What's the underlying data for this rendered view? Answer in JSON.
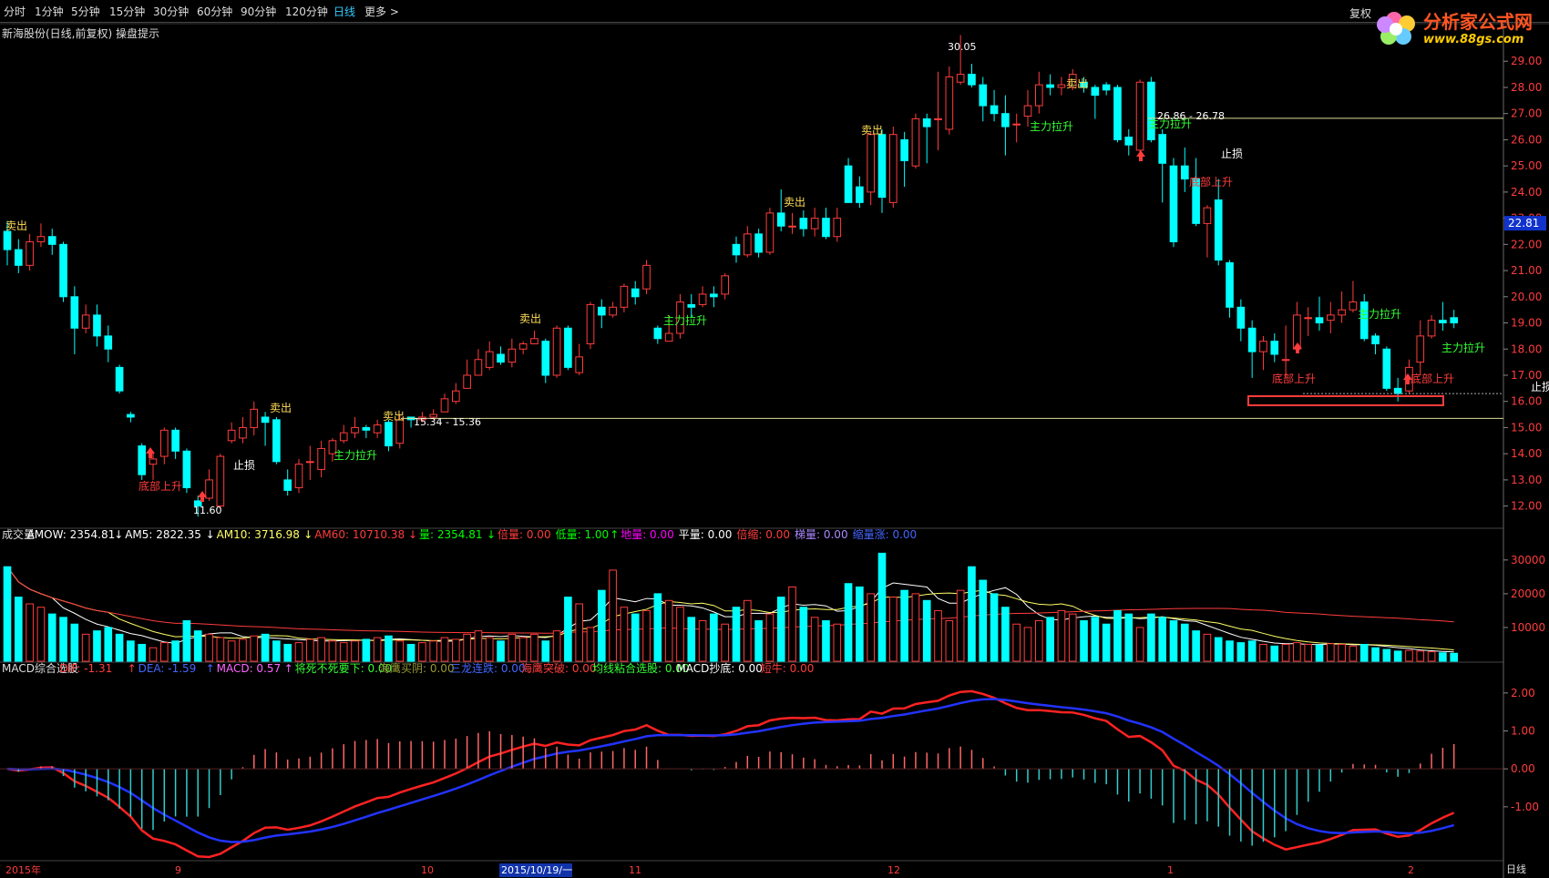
{
  "toolbar": {
    "tabs": [
      "分时",
      "1分钟",
      "5分钟",
      "15分钟",
      "30分钟",
      "60分钟",
      "90分钟",
      "120分钟",
      "日线",
      "更多 >"
    ],
    "active_tab": "日线",
    "fuquan": "复权"
  },
  "title": "新海股份(日线,前复权) 操盘提示",
  "logo": {
    "name": "分析家公式网",
    "url": "www.88gs.com"
  },
  "colors": {
    "up": "#ff3c3c",
    "down": "#00ffff",
    "ma_white": "#ffffff",
    "ma_yellow": "#ffff00",
    "ma_red": "#ff3c3c",
    "bg": "#000000"
  },
  "price_axis": [
    "29.00",
    "28.00",
    "27.00",
    "26.00",
    "25.00",
    "24.00",
    "23.00",
    "22.00",
    "21.00",
    "20.00",
    "19.00",
    "18.00",
    "17.00",
    "16.00",
    "15.00",
    "14.00",
    "13.00",
    "12.00"
  ],
  "current_price": "22.81",
  "price_annotations": {
    "high": "30.05",
    "low": "11.60",
    "range1": "15.34 - 15.36",
    "range2": "26.86 - 26.78",
    "stop": "止损",
    "sell": "卖出",
    "main_up": "主力拉升",
    "bottom_up": "底部上升"
  },
  "volume_legend": [
    {
      "label": "成交量",
      "color": "#dddddd"
    },
    {
      "label": "AMOW: 2354.81",
      "color": "#ffffff",
      "arrow": "↓"
    },
    {
      "label": "AM5: 2822.35",
      "color": "#ffffff",
      "arrow": "↓"
    },
    {
      "label": "AM10: 3716.98",
      "color": "#ffff66",
      "arrow": "↓"
    },
    {
      "label": "AM60: 10710.38",
      "color": "#ff3c3c",
      "arrow": "↓"
    },
    {
      "label": "量: 2354.81",
      "color": "#00ff00",
      "arrow": "↓"
    },
    {
      "label": "倍量: 0.00",
      "color": "#ff3c3c"
    },
    {
      "label": "低量: 1.00",
      "color": "#00ff00",
      "arrow": "↑"
    },
    {
      "label": "地量: 0.00",
      "color": "#ff00ff"
    },
    {
      "label": "平量: 0.00",
      "color": "#ffffff"
    },
    {
      "label": "倍缩: 0.00",
      "color": "#ff3c3c"
    },
    {
      "label": "梯量: 0.00",
      "color": "#aa88ff"
    },
    {
      "label": "缩量涨: 0.00",
      "color": "#4466ff"
    }
  ],
  "volume_axis": [
    "30000",
    "20000",
    "10000"
  ],
  "macd_legend": [
    {
      "label": "MACD综合选股",
      "color": "#dddddd"
    },
    {
      "label": "DIF: -1.31",
      "color": "#ff3c3c",
      "arrow": "↑"
    },
    {
      "label": "DEA: -1.59",
      "color": "#4466ff",
      "arrow": "↑"
    },
    {
      "label": "MACD: 0.57",
      "color": "#ff66ff",
      "arrow": "↑"
    },
    {
      "label": "将死不死要下: 0.00",
      "color": "#33ff33"
    },
    {
      "label": "海鹰买阴: 0.00",
      "color": "#999933"
    },
    {
      "label": "三龙连跌: 0.00",
      "color": "#4466ff"
    },
    {
      "label": "海鹰突破: 0.00",
      "color": "#ff3c3c"
    },
    {
      "label": "均线粘合选股: 0.00",
      "color": "#33ff33"
    },
    {
      "label": "MACD抄底: 0.00",
      "color": "#ffffff"
    },
    {
      "label": "短牛: 0.00",
      "color": "#ff3c3c"
    }
  ],
  "macd_axis": [
    "2.00",
    "1.00",
    "0.00",
    "-1.00"
  ],
  "date_axis": [
    {
      "label": "2015年"
    },
    {
      "label": "9"
    },
    {
      "label": "10"
    },
    {
      "label": "2015/10/19/一"
    },
    {
      "label": "11"
    },
    {
      "label": "12"
    },
    {
      "label": "1"
    },
    {
      "label": "2"
    }
  ],
  "period": "日线",
  "chart_data": {
    "type": "candlestick",
    "title": "新海股份(日线,前复权)",
    "ylim": [
      11.5,
      29.6
    ],
    "candles": [
      [
        22.5,
        21.8,
        22.9,
        21.2
      ],
      [
        21.8,
        21.2,
        22.2,
        20.9
      ],
      [
        21.2,
        22.1,
        22.4,
        21.0
      ],
      [
        22.1,
        22.3,
        22.8,
        21.9
      ],
      [
        22.3,
        22.0,
        22.6,
        21.6
      ],
      [
        22.0,
        20.0,
        22.1,
        19.8
      ],
      [
        20.0,
        18.8,
        20.4,
        17.8
      ],
      [
        18.8,
        19.3,
        19.7,
        18.6
      ],
      [
        19.3,
        18.5,
        19.7,
        18.1
      ],
      [
        18.5,
        18.0,
        18.9,
        17.5
      ],
      [
        17.3,
        16.4,
        17.4,
        16.3
      ],
      [
        15.5,
        15.4,
        15.6,
        15.2
      ],
      [
        14.3,
        13.2,
        14.4,
        13.0
      ],
      [
        13.6,
        13.8,
        14.1,
        13.0
      ],
      [
        13.9,
        14.9,
        15.0,
        13.6
      ],
      [
        14.9,
        14.1,
        15.0,
        13.8
      ],
      [
        14.1,
        12.7,
        14.2,
        12.5
      ],
      [
        12.2,
        12.0,
        12.4,
        11.6
      ],
      [
        12.3,
        13.0,
        13.4,
        12.2
      ],
      [
        12.0,
        13.9,
        14.0,
        11.9
      ],
      [
        14.5,
        14.9,
        15.2,
        14.4
      ],
      [
        14.6,
        15.0,
        15.4,
        14.4
      ],
      [
        15.0,
        15.7,
        16.0,
        14.7
      ],
      [
        15.4,
        15.2,
        15.6,
        14.3
      ],
      [
        15.3,
        13.7,
        15.4,
        13.6
      ],
      [
        13.0,
        12.6,
        13.4,
        12.4
      ],
      [
        12.7,
        13.6,
        13.8,
        12.5
      ],
      [
        13.7,
        13.7,
        14.3,
        13.0
      ],
      [
        13.4,
        14.2,
        14.5,
        13.1
      ],
      [
        14.0,
        14.5,
        14.6,
        13.7
      ],
      [
        14.5,
        14.8,
        15.1,
        14.4
      ],
      [
        14.8,
        15.0,
        15.4,
        14.6
      ],
      [
        15.0,
        14.9,
        15.1,
        14.6
      ],
      [
        14.8,
        15.1,
        15.3,
        14.6
      ],
      [
        15.2,
        14.3,
        15.3,
        14.1
      ],
      [
        14.4,
        15.3,
        15.5,
        14.2
      ],
      [
        15.4,
        15.3,
        15.4,
        15.0
      ],
      [
        15.3,
        15.4,
        15.6,
        15.2
      ],
      [
        15.4,
        15.5,
        15.7,
        15.3
      ],
      [
        15.6,
        16.1,
        16.3,
        15.7
      ],
      [
        16.0,
        16.4,
        16.7,
        15.9
      ],
      [
        16.5,
        17.0,
        17.6,
        16.5
      ],
      [
        17.0,
        17.6,
        18.0,
        17.0
      ],
      [
        17.3,
        17.9,
        18.3,
        17.2
      ],
      [
        17.8,
        17.5,
        18.1,
        17.4
      ],
      [
        17.5,
        18.0,
        18.4,
        17.3
      ],
      [
        18.0,
        18.2,
        18.3,
        17.8
      ],
      [
        18.2,
        18.4,
        18.7,
        18.2
      ],
      [
        18.3,
        17.0,
        18.4,
        16.7
      ],
      [
        17.0,
        18.8,
        18.9,
        16.9
      ],
      [
        18.8,
        17.3,
        18.9,
        17.2
      ],
      [
        17.1,
        17.7,
        18.2,
        17.0
      ],
      [
        18.2,
        19.7,
        19.8,
        18.0
      ],
      [
        19.6,
        19.3,
        19.9,
        18.8
      ],
      [
        19.3,
        19.6,
        19.8,
        19.2
      ],
      [
        19.6,
        20.4,
        20.5,
        19.4
      ],
      [
        20.3,
        20.0,
        20.6,
        19.7
      ],
      [
        20.3,
        21.2,
        21.4,
        20.1
      ],
      [
        18.8,
        18.4,
        18.9,
        18.2
      ],
      [
        18.3,
        18.6,
        19.3,
        18.3
      ],
      [
        18.6,
        19.8,
        20.1,
        18.4
      ],
      [
        19.7,
        19.6,
        20.1,
        19.2
      ],
      [
        19.7,
        20.1,
        20.4,
        19.6
      ],
      [
        20.1,
        20.0,
        20.4,
        19.6
      ],
      [
        20.1,
        20.8,
        20.9,
        19.9
      ],
      [
        22.0,
        21.6,
        22.3,
        21.3
      ],
      [
        21.6,
        22.4,
        22.7,
        21.5
      ],
      [
        22.4,
        21.7,
        22.6,
        21.5
      ],
      [
        21.7,
        23.2,
        23.4,
        21.6
      ],
      [
        23.2,
        22.7,
        24.1,
        22.5
      ],
      [
        22.7,
        22.7,
        23.2,
        22.4
      ],
      [
        23.0,
        22.6,
        23.3,
        22.3
      ],
      [
        22.6,
        23.0,
        23.4,
        22.3
      ],
      [
        23.0,
        22.3,
        23.4,
        22.2
      ],
      [
        22.3,
        23.0,
        23.4,
        22.1
      ],
      [
        25.0,
        23.6,
        25.3,
        23.6
      ],
      [
        24.2,
        23.6,
        24.6,
        23.4
      ],
      [
        24.0,
        26.2,
        26.3,
        23.5
      ],
      [
        26.2,
        23.8,
        26.4,
        23.2
      ],
      [
        23.6,
        26.2,
        26.5,
        23.4
      ],
      [
        26.0,
        25.2,
        26.3,
        24.2
      ],
      [
        25.0,
        26.8,
        27.0,
        24.9
      ],
      [
        26.8,
        26.5,
        27.0,
        25.1
      ],
      [
        26.8,
        26.8,
        28.6,
        25.6
      ],
      [
        26.4,
        28.4,
        28.8,
        26.2
      ],
      [
        28.2,
        28.5,
        30.0,
        28.1
      ],
      [
        28.5,
        28.1,
        28.9,
        28.0
      ],
      [
        28.1,
        27.3,
        28.4,
        26.7
      ],
      [
        27.3,
        27.0,
        27.9,
        26.7
      ],
      [
        27.0,
        26.5,
        27.7,
        25.4
      ],
      [
        26.6,
        26.6,
        27.0,
        25.9
      ],
      [
        26.9,
        27.3,
        27.9,
        26.5
      ],
      [
        27.3,
        28.1,
        28.6,
        27.0
      ],
      [
        28.1,
        28.0,
        28.5,
        27.7
      ],
      [
        28.0,
        28.1,
        28.4,
        27.7
      ],
      [
        28.0,
        28.5,
        28.7,
        27.9
      ],
      [
        28.2,
        28.0,
        28.4,
        27.8
      ],
      [
        28.0,
        27.7,
        28.1,
        26.8
      ],
      [
        28.1,
        27.9,
        28.2,
        27.7
      ],
      [
        28.0,
        26.0,
        28.1,
        25.9
      ],
      [
        26.1,
        25.8,
        26.4,
        25.4
      ],
      [
        25.6,
        28.2,
        28.3,
        25.5
      ],
      [
        28.2,
        26.0,
        28.4,
        25.9
      ],
      [
        26.2,
        25.1,
        26.4,
        23.6
      ],
      [
        25.0,
        22.1,
        25.3,
        21.9
      ],
      [
        25.0,
        24.5,
        25.7,
        24.0
      ],
      [
        24.5,
        22.8,
        25.3,
        22.7
      ],
      [
        22.8,
        23.4,
        23.5,
        21.5
      ],
      [
        23.7,
        21.4,
        24.5,
        21.2
      ],
      [
        21.3,
        19.6,
        21.4,
        19.2
      ],
      [
        19.6,
        18.8,
        19.9,
        18.3
      ],
      [
        18.8,
        17.9,
        19.1,
        16.9
      ],
      [
        17.9,
        18.3,
        18.5,
        17.2
      ],
      [
        18.3,
        17.8,
        18.6,
        17.5
      ],
      [
        17.6,
        17.6,
        18.9,
        16.9
      ],
      [
        18.0,
        19.3,
        19.8,
        17.9
      ],
      [
        19.2,
        19.2,
        19.6,
        18.5
      ],
      [
        19.2,
        19.0,
        20.0,
        18.7
      ],
      [
        19.1,
        19.3,
        19.8,
        18.6
      ],
      [
        19.3,
        19.5,
        20.2,
        19.0
      ],
      [
        19.5,
        19.8,
        20.6,
        19.4
      ],
      [
        19.8,
        18.4,
        20.1,
        18.3
      ],
      [
        18.5,
        18.2,
        18.6,
        17.8
      ],
      [
        18.0,
        16.5,
        18.1,
        16.4
      ],
      [
        16.5,
        16.3,
        16.9,
        16.0
      ],
      [
        16.4,
        17.3,
        17.6,
        16.3
      ],
      [
        17.5,
        18.5,
        19.1,
        17.0
      ],
      [
        18.5,
        19.1,
        19.3,
        18.4
      ],
      [
        19.1,
        19.0,
        19.8,
        18.7
      ],
      [
        19.2,
        19.0,
        19.5,
        18.8
      ]
    ],
    "volume": [
      28000,
      19000,
      17000,
      16000,
      14000,
      13000,
      11000,
      8000,
      9000,
      10000,
      8000,
      6000,
      5000,
      4000,
      5500,
      6000,
      12000,
      9000,
      8000,
      7000,
      6000,
      6500,
      7500,
      8000,
      6000,
      5000,
      5500,
      6500,
      7000,
      6000,
      5500,
      6000,
      6500,
      7000,
      7500,
      6000,
      5000,
      5500,
      6000,
      7000,
      6500,
      8000,
      9000,
      7000,
      6000,
      8000,
      7000,
      8000,
      6000,
      9000,
      19000,
      17000,
      10000,
      21000,
      27000,
      16000,
      14000,
      15000,
      20000,
      18000,
      16000,
      13000,
      12000,
      14000,
      11000,
      16000,
      18000,
      12000,
      14000,
      19000,
      22000,
      16000,
      13000,
      12000,
      11000,
      23000,
      22000,
      20000,
      32000,
      19000,
      21000,
      20000,
      18000,
      15000,
      12000,
      21000,
      28000,
      24000,
      20000,
      16000,
      11000,
      10000,
      12000,
      13000,
      15000,
      14000,
      12000,
      13000,
      11000,
      15000,
      14000,
      10000,
      14000,
      13000,
      12000,
      11000,
      9000,
      8000,
      7000,
      6000,
      5500,
      6000,
      5000,
      4500,
      5000,
      5500,
      5000,
      4800,
      5200,
      5000,
      4500,
      5000,
      4000,
      3500,
      3000,
      3200,
      3000,
      2800,
      2500,
      2354
    ]
  }
}
